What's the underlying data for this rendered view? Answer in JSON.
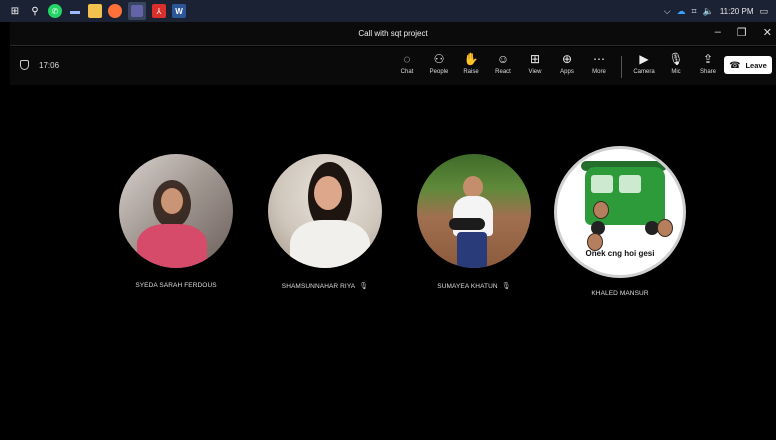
{
  "taskbar": {
    "icons": [
      "windows-start-icon",
      "search-icon",
      "whatsapp-icon",
      "task-view-icon",
      "file-explorer-icon",
      "firefox-icon",
      "teams-icon",
      "pdf-icon",
      "word-icon"
    ],
    "tray": {
      "time": "11:20 PM"
    }
  },
  "window": {
    "title": "Call with sqt project"
  },
  "call": {
    "timer": "17:06",
    "tools": [
      {
        "name": "chat",
        "label": "Chat"
      },
      {
        "name": "people",
        "label": "People"
      },
      {
        "name": "raise",
        "label": "Raise"
      },
      {
        "name": "react",
        "label": "React"
      },
      {
        "name": "view",
        "label": "View"
      },
      {
        "name": "apps",
        "label": "Apps"
      },
      {
        "name": "more",
        "label": "More"
      }
    ],
    "media": [
      {
        "name": "camera",
        "label": "Camera"
      },
      {
        "name": "mic",
        "label": "Mic"
      },
      {
        "name": "share",
        "label": "Share"
      }
    ],
    "leave_label": "Leave"
  },
  "participants": [
    {
      "name": "SYEDA SARAH FERDOUS",
      "muted": false
    },
    {
      "name": "SHAMSUNNAHAR RIYA",
      "muted": true
    },
    {
      "name": "SUMAYEA KHATUN",
      "muted": true
    },
    {
      "name": "KHALED MANSUR",
      "muted": false,
      "avatar_caption": "Onek cng hoi gesi"
    }
  ],
  "colors": {
    "background": "#000000",
    "taskbar": "#1b2233",
    "leave_button": "#ffffff"
  }
}
